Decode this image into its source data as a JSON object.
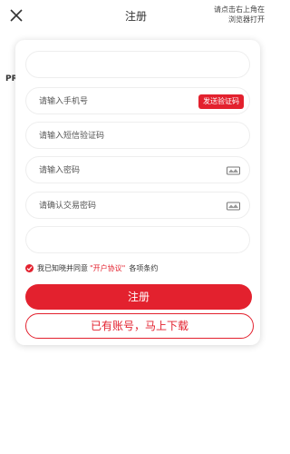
{
  "header": {
    "title": "注册",
    "hint_line1": "请点击右上角在",
    "hint_line2": "浏览器打开",
    "prev_label": "PREV"
  },
  "form": {
    "phone_placeholder": "请输入手机号",
    "send_code_label": "发送验证码",
    "sms_placeholder": "请输入短信验证码",
    "password_placeholder": "请输入密码",
    "trade_password_placeholder": "请确认交易密码"
  },
  "agreement": {
    "prefix": "我已知晓并同意",
    "link": "\"开户协议\"",
    "suffix": "各项条约"
  },
  "actions": {
    "register_label": "注册",
    "download_label": "已有账号，马上下载"
  },
  "colors": {
    "accent": "#e3212e"
  },
  "icons": {
    "close": "close-icon",
    "password_toggle": "eye-icon"
  }
}
